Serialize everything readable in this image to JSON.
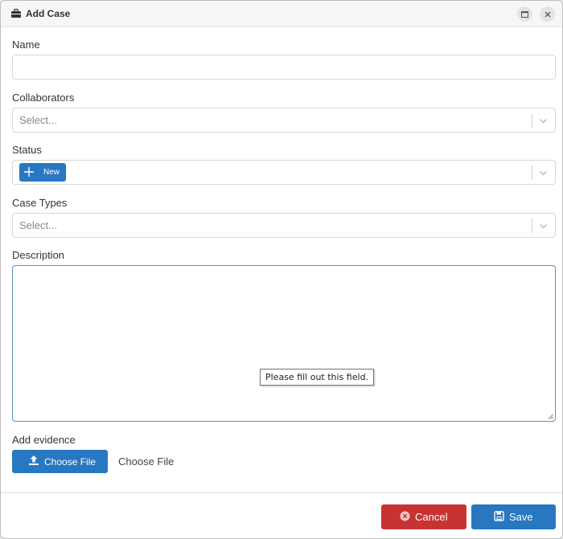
{
  "window": {
    "title": "Add Case",
    "icons": {
      "title": "briefcase-icon",
      "maximize": "maximize-icon",
      "close": "close-icon"
    }
  },
  "form": {
    "name": {
      "label": "Name",
      "value": ""
    },
    "collaborators": {
      "label": "Collaborators",
      "placeholder": "Select..."
    },
    "status": {
      "label": "Status",
      "selected": "New"
    },
    "case_types": {
      "label": "Case Types",
      "placeholder": "Select..."
    },
    "description": {
      "label": "Description",
      "value": "",
      "validation_tooltip": "Please fill out this field."
    },
    "evidence": {
      "label": "Add evidence",
      "button_label": "Choose File",
      "file_text": "Choose File"
    }
  },
  "footer": {
    "cancel_label": "Cancel",
    "save_label": "Save"
  },
  "colors": {
    "primary": "#2777c1",
    "danger": "#c73333",
    "focus_border": "#5b8fc7"
  }
}
